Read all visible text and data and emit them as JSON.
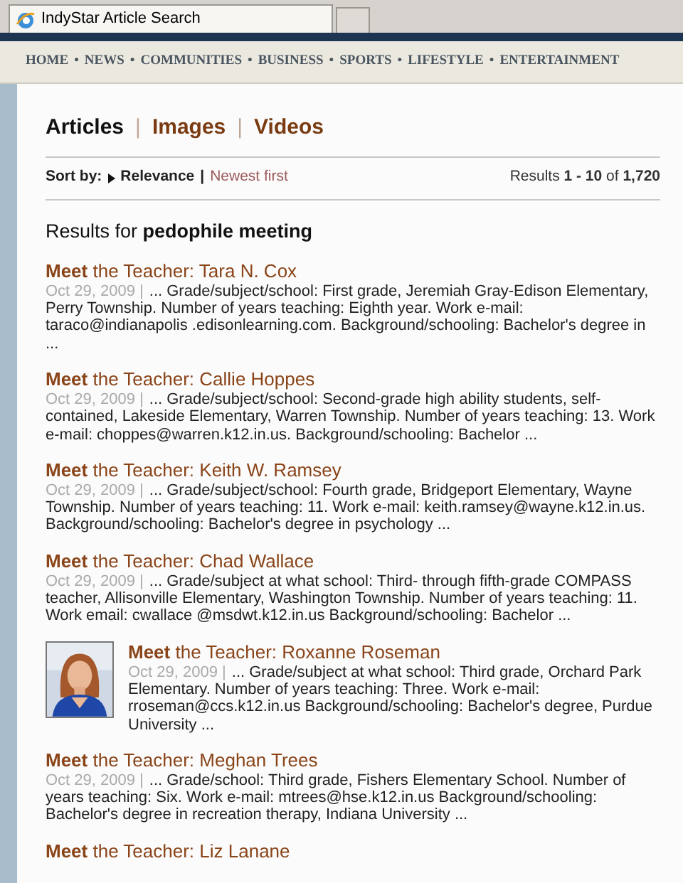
{
  "browser_tabs": [
    {
      "title": "IndyStar Article Search",
      "selected": true
    },
    {
      "selected": false
    }
  ],
  "nav": {
    "separator": "•",
    "items": [
      "HOME",
      "NEWS",
      "COMMUNITIES",
      "BUSINESS",
      "SPORTS",
      "LIFESTYLE",
      "ENTERTAINMENT"
    ]
  },
  "media_tabs": {
    "separator": "|",
    "items": [
      {
        "label": "Articles",
        "selected": true
      },
      {
        "label": "Images",
        "selected": false
      },
      {
        "label": "Videos",
        "selected": false
      }
    ]
  },
  "sort": {
    "label": "Sort by:",
    "separator": "|",
    "options": [
      {
        "label": "Relevance",
        "selected": true
      },
      {
        "label": "Newest first",
        "selected": false
      }
    ]
  },
  "results_count": "Results  **1 - 10** of **1,720**",
  "results_heading": "Results for **pedophile meeting**",
  "results": [
    {
      "title": "**Meet** the Teacher: Tara N. Cox",
      "date": "Oct 29, 2009 |",
      "snippet": "... Grade/subject/school: First grade, Jeremiah Gray-Edison Elementary, Perry Township. Number of years teaching: Eighth year. Work e-mail: taraco@indianapolis .edisonlearning.com. Background/schooling: Bachelor's degree in ..."
    },
    {
      "title": "**Meet** the Teacher: Callie Hoppes",
      "date": "Oct 29, 2009 |",
      "snippet": "... Grade/subject/school: Second-grade high ability students, self-contained, Lakeside Elementary, Warren Township. Number of years teaching: 13. Work e-mail: choppes@warren.k12.in.us. Background/schooling: Bachelor ..."
    },
    {
      "title": "**Meet** the Teacher: Keith W. Ramsey",
      "date": "Oct 29, 2009 |",
      "snippet": "... Grade/subject/school: Fourth grade, Bridgeport Elementary, Wayne Township. Number of years teaching: 11. Work e-mail: keith.ramsey@wayne.k12.in.us. Background/schooling: Bachelor's degree in psychology ..."
    },
    {
      "title": "**Meet** the Teacher: Chad Wallace",
      "date": "Oct 29, 2009 |",
      "snippet": "... Grade/subject at what school: Third- through fifth-grade COMPASS teacher, Allisonville Elementary, Washington Township. Number of years teaching: 11. Work email: cwallace @msdwt.k12.in.us Background/schooling: Bachelor ..."
    },
    {
      "title": "**Meet** the Teacher: Roxanne Roseman",
      "date": "Oct 29, 2009 |",
      "snippet": "... Grade/subject at what school: Third grade, Orchard Park Elementary. Number of years teaching: Three. Work e-mail: rroseman@ccs.k12.in.us Background/schooling: Bachelor's degree, Purdue University ..."
    },
    {
      "title": "**Meet** the Teacher: Meghan Trees",
      "date": "Oct 29, 2009 |",
      "snippet": "... Grade/school: Third grade, Fishers Elementary School. Number of years teaching: Six. Work e-mail: mtrees@hse.k12.in.us Background/schooling: Bachelor's degree in recreation therapy, Indiana University ..."
    },
    {
      "title": "**Meet** the Teacher: Liz Lanane"
    }
  ]
}
